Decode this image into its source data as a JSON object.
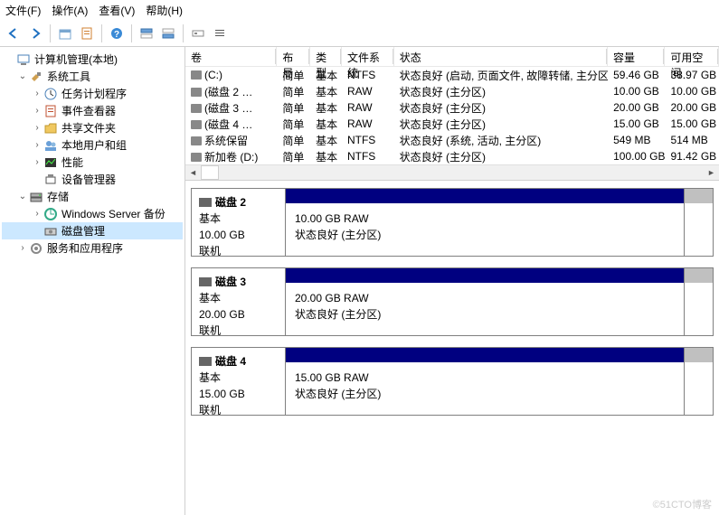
{
  "menu": {
    "file": "文件(F)",
    "action": "操作(A)",
    "view": "查看(V)",
    "help": "帮助(H)"
  },
  "tree": {
    "root": "计算机管理(本地)",
    "systools": "系统工具",
    "scheduler": "任务计划程序",
    "eventvwr": "事件查看器",
    "shared": "共享文件夹",
    "users": "本地用户和组",
    "perf": "性能",
    "devmgr": "设备管理器",
    "storage": "存储",
    "wsbackup": "Windows Server 备份",
    "diskmgmt": "磁盘管理",
    "services": "服务和应用程序"
  },
  "cols": {
    "vol": "卷",
    "layout": "布局",
    "type": "类型",
    "fs": "文件系统",
    "status": "状态",
    "cap": "容量",
    "free": "可用空间"
  },
  "rows": [
    {
      "vol": "(C:)",
      "layout": "简单",
      "type": "基本",
      "fs": "NTFS",
      "status": "状态良好 (启动, 页面文件, 故障转储, 主分区)",
      "cap": "59.46 GB",
      "free": "38.97 GB"
    },
    {
      "vol": "(磁盘 2 …",
      "layout": "简单",
      "type": "基本",
      "fs": "RAW",
      "status": "状态良好 (主分区)",
      "cap": "10.00 GB",
      "free": "10.00 GB"
    },
    {
      "vol": "(磁盘 3 …",
      "layout": "简单",
      "type": "基本",
      "fs": "RAW",
      "status": "状态良好 (主分区)",
      "cap": "20.00 GB",
      "free": "20.00 GB"
    },
    {
      "vol": "(磁盘 4 …",
      "layout": "简单",
      "type": "基本",
      "fs": "RAW",
      "status": "状态良好 (主分区)",
      "cap": "15.00 GB",
      "free": "15.00 GB"
    },
    {
      "vol": "系统保留",
      "layout": "简单",
      "type": "基本",
      "fs": "NTFS",
      "status": "状态良好 (系统, 活动, 主分区)",
      "cap": "549 MB",
      "free": "514 MB"
    },
    {
      "vol": "新加卷 (D:)",
      "layout": "简单",
      "type": "基本",
      "fs": "NTFS",
      "status": "状态良好 (主分区)",
      "cap": "100.00 GB",
      "free": "91.42 GB"
    }
  ],
  "disks": [
    {
      "name": "磁盘 2",
      "type": "基本",
      "size": "10.00 GB",
      "state": "联机",
      "part_text1": "10.00 GB RAW",
      "part_text2": "状态良好 (主分区)"
    },
    {
      "name": "磁盘 3",
      "type": "基本",
      "size": "20.00 GB",
      "state": "联机",
      "part_text1": "20.00 GB RAW",
      "part_text2": "状态良好 (主分区)"
    },
    {
      "name": "磁盘 4",
      "type": "基本",
      "size": "15.00 GB",
      "state": "联机",
      "part_text1": "15.00 GB RAW",
      "part_text2": "状态良好 (主分区)"
    }
  ],
  "watermark": "©51CTO博客"
}
